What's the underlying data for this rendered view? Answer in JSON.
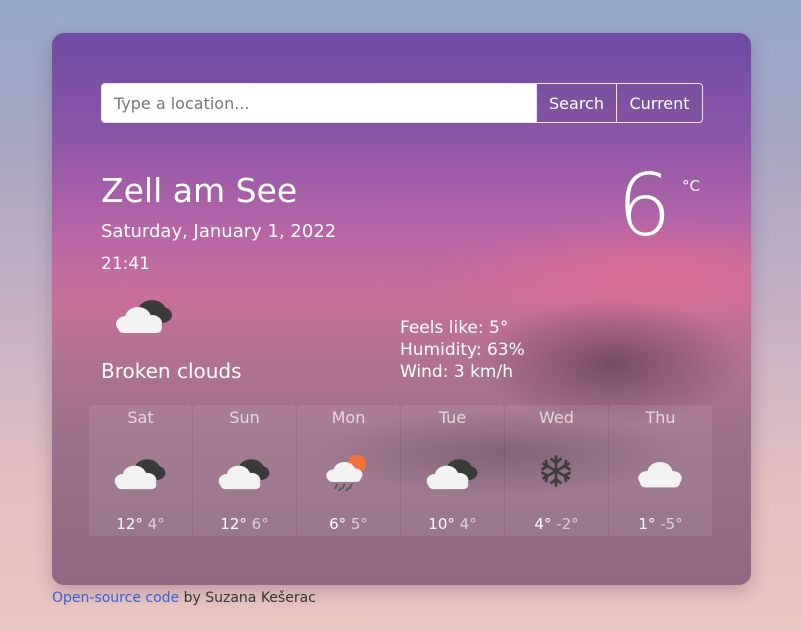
{
  "search": {
    "placeholder": "Type a location...",
    "search_label": "Search",
    "current_label": "Current"
  },
  "weather": {
    "city": "Zell am See",
    "date": "Saturday, January 1, 2022",
    "time": "21:41",
    "description": "Broken clouds",
    "temperature": "6",
    "unit": "°C",
    "icon": "broken-clouds-icon",
    "feels_like": "Feels like: 5°",
    "humidity": "Humidity: 63%",
    "wind": "Wind: 3 km/h"
  },
  "forecast": [
    {
      "day": "Sat",
      "max": "12°",
      "min": "4°",
      "icon": "broken-clouds-icon"
    },
    {
      "day": "Sun",
      "max": "12°",
      "min": "6°",
      "icon": "broken-clouds-icon"
    },
    {
      "day": "Mon",
      "max": "6°",
      "min": "5°",
      "icon": "rain-sun-icon"
    },
    {
      "day": "Tue",
      "max": "10°",
      "min": "4°",
      "icon": "broken-clouds-icon"
    },
    {
      "day": "Wed",
      "max": "4°",
      "min": "-2°",
      "icon": "snow-icon"
    },
    {
      "day": "Thu",
      "max": "1°",
      "min": "-5°",
      "icon": "cloud-icon"
    }
  ],
  "footer": {
    "link_text": "Open-source code",
    "suffix": " by Suzana Kešerac"
  },
  "colors": {
    "link": "#3b5bdb",
    "card_top": "#6f4aa3",
    "card_mid": "#c86f9a"
  }
}
